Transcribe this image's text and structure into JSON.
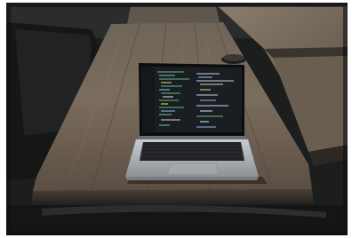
{
  "photo": {
    "subject": "laptop-on-wooden-table",
    "colors": {
      "background": "#1c1f1e",
      "table_light": "#7a6c5c",
      "table_dark": "#3e3630",
      "laptop_body": "#b9bcbf",
      "screen": "#1a1d22",
      "keyboard": "#222327"
    }
  }
}
